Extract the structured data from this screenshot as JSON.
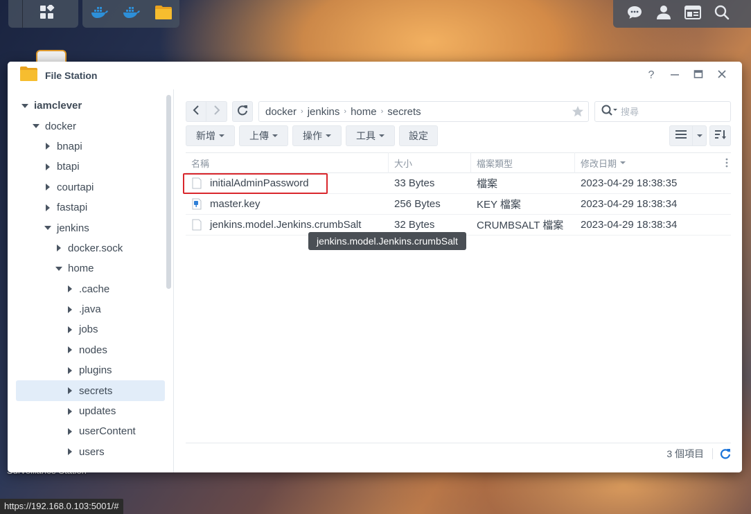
{
  "taskbar": {
    "left_icons": [
      "main-menu-icon"
    ],
    "apps": [
      "docker-icon",
      "docker-icon",
      "folder-icon"
    ],
    "right_icons": [
      "chat-icon",
      "user-icon",
      "widgets-icon",
      "search-icon"
    ]
  },
  "desktop": {
    "label": "Surveillance Station",
    "status_url": "https://192.168.0.103:5001/#"
  },
  "window": {
    "title": "File Station",
    "help": "?",
    "accent": "#f3b326"
  },
  "sidebar": {
    "items": [
      {
        "label": "iamclever",
        "level": 0,
        "expanded": true
      },
      {
        "label": "docker",
        "level": 1,
        "expanded": true
      },
      {
        "label": "bnapi",
        "level": 2,
        "expanded": false
      },
      {
        "label": "btapi",
        "level": 2,
        "expanded": false
      },
      {
        "label": "courtapi",
        "level": 2,
        "expanded": false
      },
      {
        "label": "fastapi",
        "level": 2,
        "expanded": false
      },
      {
        "label": "jenkins",
        "level": 2,
        "expanded": true
      },
      {
        "label": "docker.sock",
        "level": 3,
        "expanded": false
      },
      {
        "label": "home",
        "level": 3,
        "expanded": true
      },
      {
        "label": ".cache",
        "level": 4,
        "expanded": false
      },
      {
        "label": ".java",
        "level": 4,
        "expanded": false
      },
      {
        "label": "jobs",
        "level": 4,
        "expanded": false
      },
      {
        "label": "nodes",
        "level": 4,
        "expanded": false
      },
      {
        "label": "plugins",
        "level": 4,
        "expanded": false
      },
      {
        "label": "secrets",
        "level": 4,
        "expanded": false,
        "selected": true
      },
      {
        "label": "updates",
        "level": 4,
        "expanded": false
      },
      {
        "label": "userContent",
        "level": 4,
        "expanded": false
      },
      {
        "label": "users",
        "level": 4,
        "expanded": false
      }
    ]
  },
  "path": {
    "crumbs": [
      "docker",
      "jenkins",
      "home",
      "secrets"
    ]
  },
  "search": {
    "placeholder": "搜尋"
  },
  "toolbar": {
    "create": "新增",
    "upload": "上傳",
    "action": "操作",
    "tools": "工具",
    "settings": "設定"
  },
  "table": {
    "headers": {
      "name": "名稱",
      "size": "大小",
      "type": "檔案類型",
      "modified": "修改日期"
    },
    "rows": [
      {
        "name": "initialAdminPassword",
        "size": "33 Bytes",
        "type": "檔案",
        "modified": "2023-04-29 18:38:35",
        "icon": "file-icon"
      },
      {
        "name": "master.key",
        "size": "256 Bytes",
        "type": "KEY 檔案",
        "modified": "2023-04-29 18:38:34",
        "icon": "key-file-icon"
      },
      {
        "name": "jenkins.model.Jenkins.crumbSalt",
        "size": "32 Bytes",
        "type": "CRUMBSALT 檔案",
        "modified": "2023-04-29 18:38:34",
        "icon": "file-icon"
      }
    ]
  },
  "tooltip": {
    "text": "jenkins.model.Jenkins.crumbSalt"
  },
  "footer": {
    "count": "3 個項目"
  },
  "colors": {
    "highlight": "#d9262c",
    "selected_bg": "#e2edf9",
    "refresh_blue": "#1a73d9"
  }
}
